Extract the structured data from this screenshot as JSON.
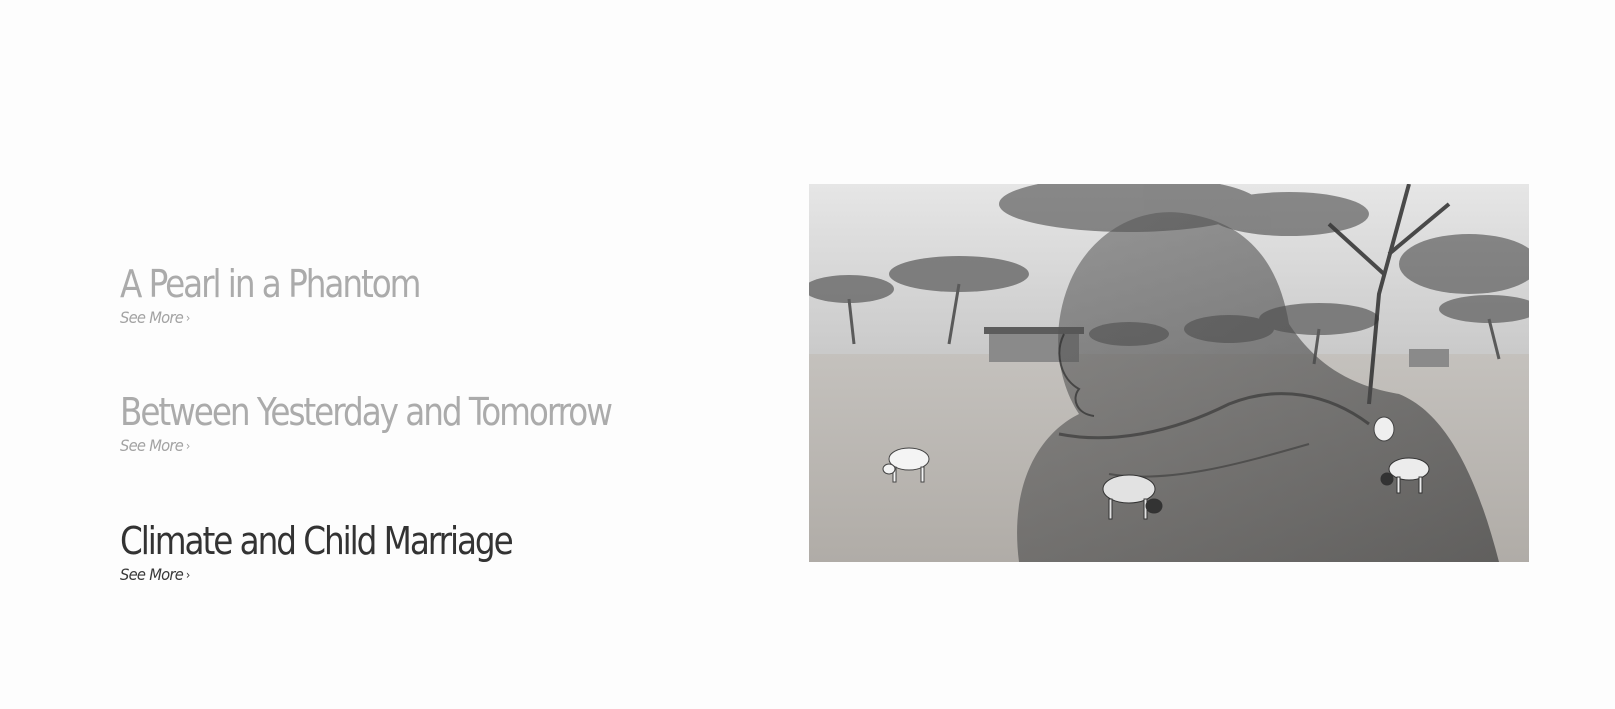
{
  "stories": [
    {
      "title": "A Pearl in a Phantom",
      "see_more": "See More",
      "active": false
    },
    {
      "title": "Between Yesterday and Tomorrow",
      "see_more": "See More",
      "active": false
    },
    {
      "title": "Climate and Child Marriage",
      "see_more": "See More",
      "active": true
    }
  ],
  "icons": {
    "see_more_chevron": "chevron-right-icon"
  },
  "colors": {
    "background": "#fdfdfd",
    "title_inactive": "#ababab",
    "title_active": "#333333"
  },
  "feature_image": {
    "description_icon": "photo-double-exposure"
  }
}
